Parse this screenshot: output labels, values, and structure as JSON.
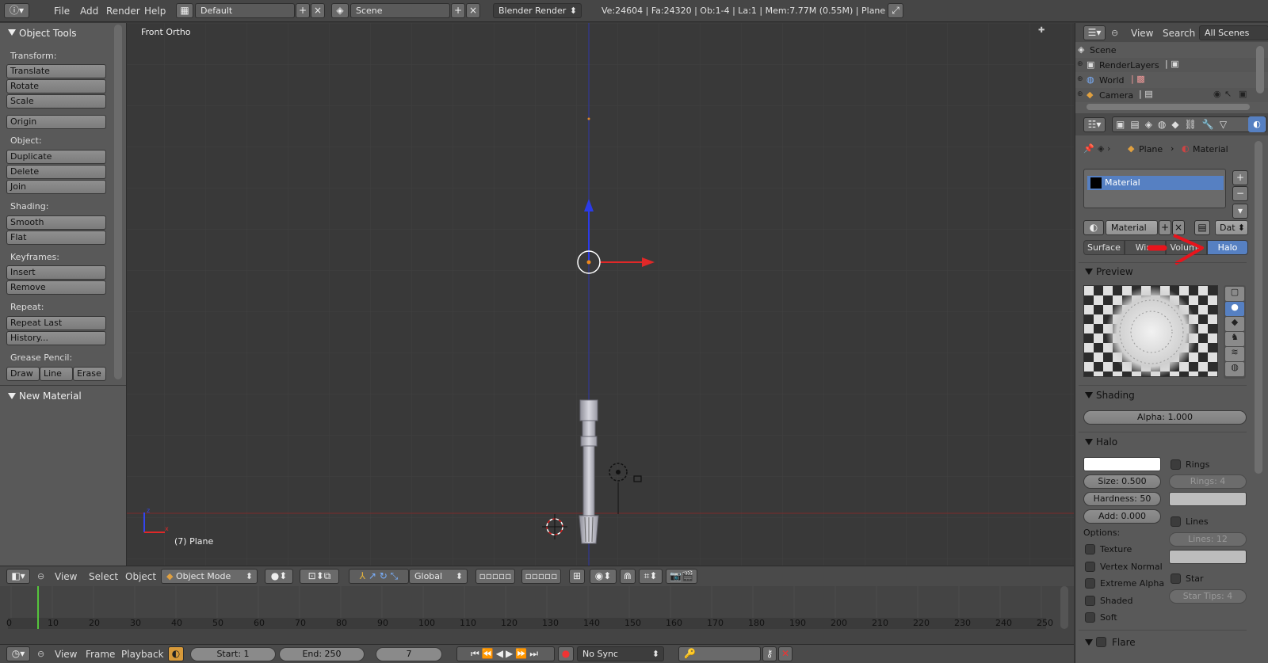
{
  "topbar": {
    "menus": [
      "File",
      "Add",
      "Render",
      "Help"
    ],
    "layout": "Default",
    "scene": "Scene",
    "engine": "Blender Render",
    "stats": "Ve:24604 | Fa:24320 | Ob:1-4 | La:1 | Mem:7.77M (0.55M) | Plane"
  },
  "tools": {
    "title": "Object Tools",
    "transform_label": "Transform:",
    "translate": "Translate",
    "rotate": "Rotate",
    "scale": "Scale",
    "origin": "Origin",
    "object_label": "Object:",
    "duplicate": "Duplicate",
    "delete": "Delete",
    "join": "Join",
    "shading_label": "Shading:",
    "smooth": "Smooth",
    "flat": "Flat",
    "keyframes_label": "Keyframes:",
    "insert": "Insert",
    "remove": "Remove",
    "repeat_label": "Repeat:",
    "repeat_last": "Repeat Last",
    "history": "History...",
    "grease_label": "Grease Pencil:",
    "draw": "Draw",
    "line": "Line",
    "erase": "Erase",
    "new_material": "New Material"
  },
  "viewport": {
    "view_name": "Front Ortho",
    "object_info": "(7) Plane"
  },
  "view_header": {
    "view": "View",
    "select": "Select",
    "object": "Object",
    "mode": "Object Mode",
    "orientation": "Global"
  },
  "timeline": {
    "ticks": [
      "0",
      "10",
      "20",
      "30",
      "40",
      "50",
      "60",
      "70",
      "80",
      "90",
      "100",
      "110",
      "120",
      "130",
      "140",
      "150",
      "160",
      "170",
      "180",
      "190",
      "200",
      "210",
      "220",
      "230",
      "240",
      "250"
    ],
    "view": "View",
    "frame": "Frame",
    "playback": "Playback",
    "start": "Start: 1",
    "end": "End: 250",
    "current": "7",
    "sync": "No Sync"
  },
  "outliner": {
    "view": "View",
    "search": "Search",
    "filter": "All Scenes",
    "items": [
      "Scene",
      "RenderLayers",
      "World",
      "Camera"
    ]
  },
  "properties": {
    "breadcrumb_object": "Plane",
    "breadcrumb_material": "Material",
    "material_slot": "Material",
    "material_name": "Material",
    "data_btn": "Dat",
    "tabs": [
      "Surface",
      "Wire",
      "Volume",
      "Halo"
    ],
    "active_tab": "Halo",
    "preview_title": "Preview",
    "shading_title": "Shading",
    "alpha": "Alpha: 1.000",
    "halo_title": "Halo",
    "rings": "Rings",
    "size": "Size: 0.500",
    "rings_count": "Rings: 4",
    "hardness": "Hardness: 50",
    "add": "Add: 0.000",
    "lines": "Lines",
    "options": "Options:",
    "lines_count": "Lines: 12",
    "texture": "Texture",
    "vertex_normal": "Vertex Normal",
    "star": "Star",
    "extreme_alpha": "Extreme Alpha",
    "star_tips": "Star Tips: 4",
    "shaded": "Shaded",
    "soft": "Soft",
    "flare_title": "Flare"
  },
  "colors": {
    "accent_blue": "#5680c2",
    "annotation_red": "#e8141c",
    "x_axis": "#d11f1f",
    "z_axis": "#2233dd",
    "timeline_cursor": "#55c43c"
  }
}
